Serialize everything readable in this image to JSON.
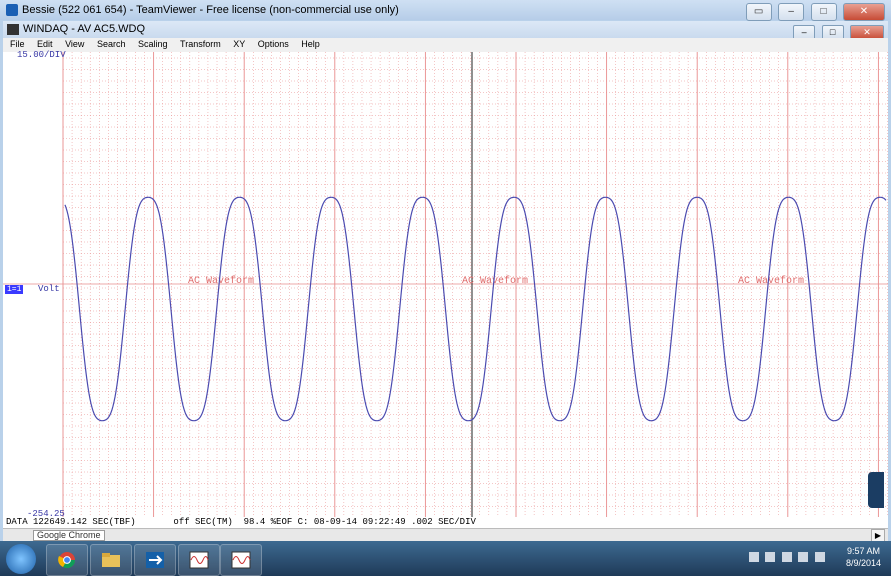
{
  "teamviewer": {
    "title": "Bessie (522 061 654) - TeamViewer - Free license (non-commercial use only)",
    "buttons": [
      "▭",
      "–",
      "□",
      "✕"
    ]
  },
  "windaq": {
    "title": "WINDAQ - AV AC5.WDQ",
    "buttons": [
      "–",
      "□",
      "✕"
    ]
  },
  "menu": [
    "File",
    "Edit",
    "View",
    "Search",
    "Scaling",
    "Transform",
    "XY",
    "Options",
    "Help"
  ],
  "plot": {
    "scale_top": "15.00/DIV",
    "scale_bottom": "-254.25",
    "channel": "1=1",
    "unit": "Volt",
    "annotations": [
      "AC Waveform",
      "AC Waveform",
      "AC Waveform"
    ],
    "grid_color": "#e88c8c",
    "trace_color": "#4b4bb0"
  },
  "status_line": "DATA 122649.142 SEC(TBF)       off SEC(TM)  98.4 %EOF C: 08-09-14 09:22:49 .002 SEC/DIV",
  "tooltip": "Google Chrome",
  "taskbar": {
    "items": [
      "windows-start",
      "chrome",
      "file-explorer",
      "teamviewer",
      "windaq-1",
      "windaq-2"
    ],
    "time": "9:57 AM",
    "date": "8/9/2014"
  }
}
